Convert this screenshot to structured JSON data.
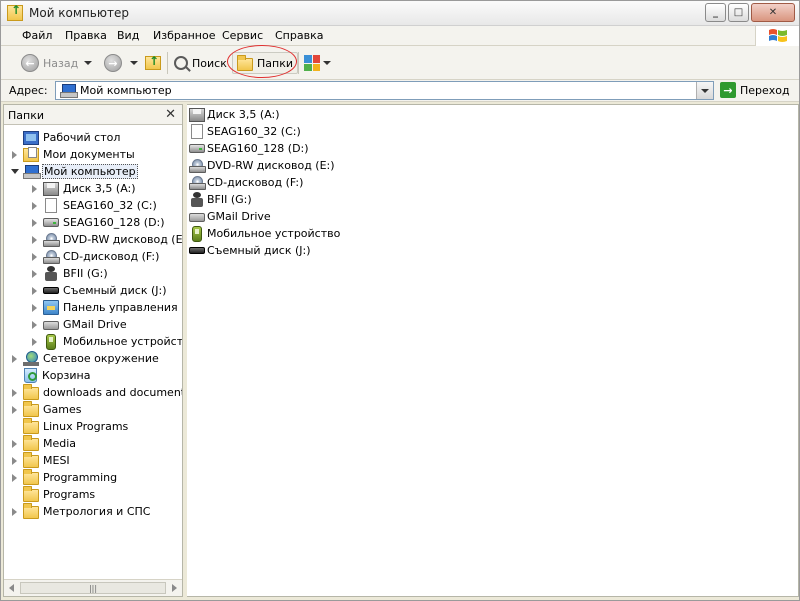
{
  "window": {
    "title": "Мой компьютер"
  },
  "menubar": {
    "items": [
      "Файл",
      "Правка",
      "Вид",
      "Избранное",
      "Сервис",
      "Справка"
    ]
  },
  "toolbar": {
    "back_label": "Назад",
    "search_label": "Поиск",
    "folders_label": "Папки"
  },
  "address": {
    "label": "Адрес:",
    "value": "Мой компьютер",
    "go_label": "Переход"
  },
  "folder_pane": {
    "title": "Папки",
    "close_glyph": "✕",
    "tree": [
      {
        "label": "Рабочий стол",
        "icon": "desktop-icon",
        "expander": "none"
      },
      {
        "label": "Мои документы",
        "icon": "my-documents-icon",
        "expander": "collapsed"
      },
      {
        "label": "Мой компьютер",
        "icon": "my-computer-icon",
        "expander": "expanded",
        "selected": true
      },
      {
        "label": "Диск 3,5 (A:)",
        "icon": "floppy-drive-icon",
        "expander": "collapsed"
      },
      {
        "label": "SEAG160_32 (C:)",
        "icon": "page-icon",
        "expander": "collapsed"
      },
      {
        "label": "SEAG160_128 (D:)",
        "icon": "hard-drive-icon",
        "expander": "collapsed"
      },
      {
        "label": "DVD-RW дисковод (E:)",
        "icon": "cd-drive-icon",
        "expander": "collapsed"
      },
      {
        "label": "CD-дисковод (F:)",
        "icon": "cd-drive-icon",
        "expander": "collapsed"
      },
      {
        "label": "BFII (G:)",
        "icon": "robot-icon",
        "expander": "collapsed"
      },
      {
        "label": "Съемный диск (J:)",
        "icon": "removable-disk-icon",
        "expander": "collapsed"
      },
      {
        "label": "Панель управления",
        "icon": "control-panel-icon",
        "expander": "collapsed"
      },
      {
        "label": "GMail Drive",
        "icon": "gmail-drive-icon",
        "expander": "collapsed"
      },
      {
        "label": "Мобильное устройство",
        "icon": "mobile-device-icon",
        "expander": "collapsed"
      },
      {
        "label": "Сетевое окружение",
        "icon": "network-icon",
        "expander": "collapsed"
      },
      {
        "label": "Корзина",
        "icon": "recycle-bin-icon",
        "expander": "none"
      },
      {
        "label": "downloads and documents",
        "icon": "folder-icon",
        "expander": "collapsed"
      },
      {
        "label": "Games",
        "icon": "folder-icon",
        "expander": "collapsed"
      },
      {
        "label": "Linux Programs",
        "icon": "folder-icon",
        "expander": "none"
      },
      {
        "label": "Media",
        "icon": "folder-icon",
        "expander": "collapsed"
      },
      {
        "label": "MESI",
        "icon": "folder-icon",
        "expander": "collapsed"
      },
      {
        "label": "Programming",
        "icon": "folder-icon",
        "expander": "collapsed"
      },
      {
        "label": "Programs",
        "icon": "folder-icon",
        "expander": "none"
      },
      {
        "label": "Метрология и СПС",
        "icon": "folder-icon",
        "expander": "collapsed"
      }
    ],
    "scrollbar_grip": "|||"
  },
  "content": {
    "items": [
      {
        "label": "Диск 3,5 (A:)",
        "icon": "floppy-drive-icon"
      },
      {
        "label": "SEAG160_32 (C:)",
        "icon": "page-icon"
      },
      {
        "label": "SEAG160_128 (D:)",
        "icon": "hard-drive-icon"
      },
      {
        "label": "DVD-RW дисковод (E:)",
        "icon": "cd-drive-icon"
      },
      {
        "label": "CD-дисковод (F:)",
        "icon": "cd-drive-icon"
      },
      {
        "label": "BFII (G:)",
        "icon": "robot-icon"
      },
      {
        "label": "GMail Drive",
        "icon": "gmail-drive-icon"
      },
      {
        "label": "Мобильное устройство",
        "icon": "mobile-device-icon"
      },
      {
        "label": "Съемный диск (J:)",
        "icon": "removable-disk-icon"
      }
    ]
  },
  "colors": {
    "highlight_ring": "#e03030",
    "go_arrow": "#2f9a2f",
    "selection_bg": "#e8eef8"
  }
}
